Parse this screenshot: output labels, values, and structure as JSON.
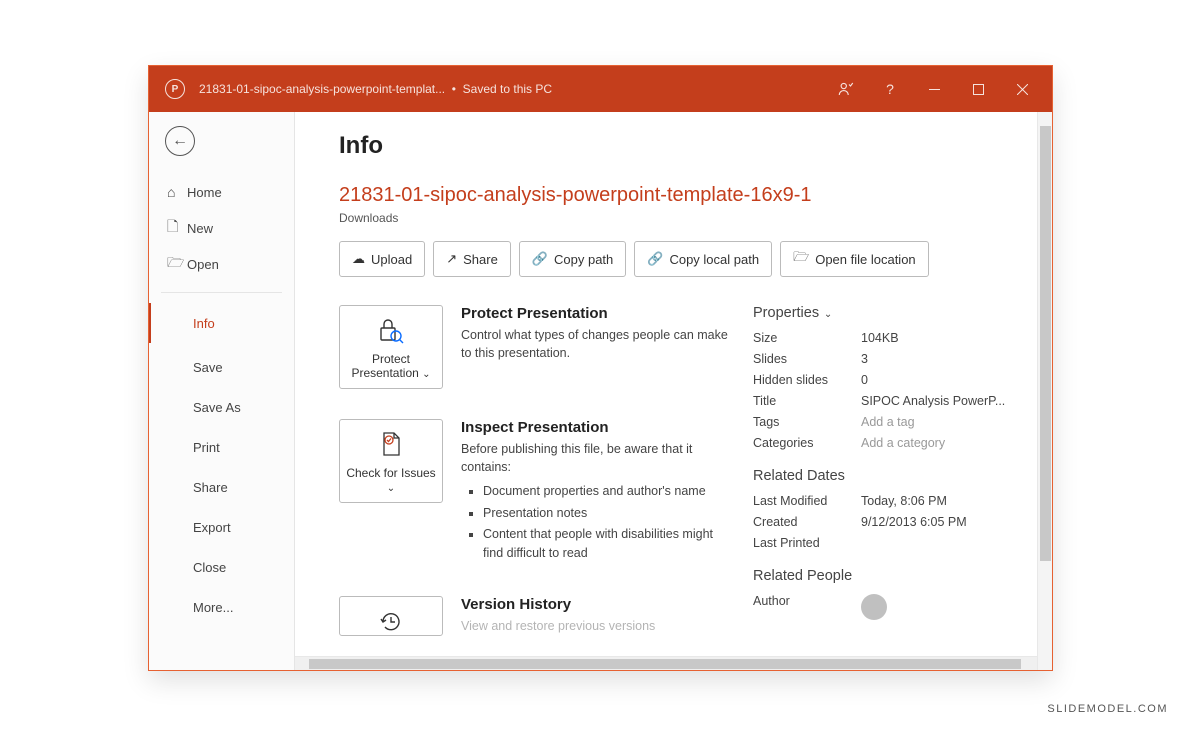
{
  "titlebar": {
    "app_initial": "P",
    "filename": "21831-01-sipoc-analysis-powerpoint-templat...",
    "saved_status": "Saved to this PC"
  },
  "sidebar": {
    "top": [
      {
        "icon": "⌂",
        "label": "Home"
      },
      {
        "icon": "🗋",
        "label": "New"
      },
      {
        "icon": "🗁",
        "label": "Open"
      }
    ],
    "bottom": [
      {
        "label": "Info",
        "active": true
      },
      {
        "label": "Save"
      },
      {
        "label": "Save As"
      },
      {
        "label": "Print"
      },
      {
        "label": "Share"
      },
      {
        "label": "Export"
      },
      {
        "label": "Close"
      },
      {
        "label": "More..."
      }
    ]
  },
  "page": {
    "title": "Info",
    "file_title": "21831-01-sipoc-analysis-powerpoint-template-16x9-1",
    "file_path": "Downloads",
    "actions": [
      {
        "icon": "☁",
        "label": "Upload"
      },
      {
        "icon": "↗",
        "label": "Share"
      },
      {
        "icon": "🔗",
        "label": "Copy path"
      },
      {
        "icon": "🔗",
        "label": "Copy local path"
      },
      {
        "icon": "🗁",
        "label": "Open file location"
      }
    ],
    "protect": {
      "button": "Protect Presentation",
      "heading": "Protect Presentation",
      "body": "Control what types of changes people can make to this presentation."
    },
    "inspect": {
      "button": "Check for Issues",
      "heading": "Inspect Presentation",
      "intro": "Before publishing this file, be aware that it contains:",
      "items": [
        "Document properties and author's name",
        "Presentation notes",
        "Content that people with disabilities might find difficult to read"
      ]
    },
    "version": {
      "heading": "Version History",
      "body": "View and restore previous versions"
    },
    "properties": {
      "head": "Properties",
      "rows": [
        {
          "k": "Size",
          "v": "104KB"
        },
        {
          "k": "Slides",
          "v": "3"
        },
        {
          "k": "Hidden slides",
          "v": "0"
        },
        {
          "k": "Title",
          "v": "SIPOC Analysis PowerP..."
        },
        {
          "k": "Tags",
          "v": "Add a tag",
          "muted": true
        },
        {
          "k": "Categories",
          "v": "Add a category",
          "muted": true
        }
      ]
    },
    "related_dates": {
      "head": "Related Dates",
      "rows": [
        {
          "k": "Last Modified",
          "v": "Today, 8:06 PM"
        },
        {
          "k": "Created",
          "v": "9/12/2013 6:05 PM"
        },
        {
          "k": "Last Printed",
          "v": ""
        }
      ]
    },
    "related_people": {
      "head": "Related People",
      "author_label": "Author"
    }
  },
  "watermark": "SLIDEMODEL.COM"
}
